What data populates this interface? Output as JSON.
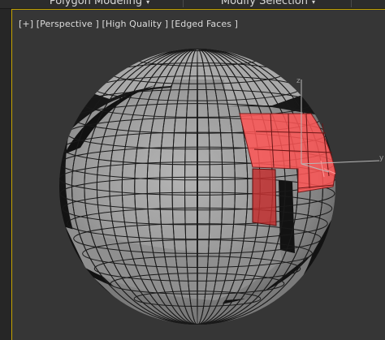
{
  "ribbon": {
    "tabs": [
      {
        "label": "Polygon Modeling",
        "arrow": "▾"
      },
      {
        "label": "Modify Selection",
        "arrow": "▾"
      }
    ]
  },
  "viewport": {
    "menus": [
      "[+]",
      "[Perspective ]",
      "[High Quality ]",
      "[Edged Faces ]"
    ]
  },
  "gizmo": {
    "z_axis": "z",
    "y_axis": "y"
  },
  "colors": {
    "active_border": "#c4a300",
    "viewport_bg": "#363636",
    "selection": "#ff4a4a",
    "mesh_edge": "#1a1a1a"
  }
}
